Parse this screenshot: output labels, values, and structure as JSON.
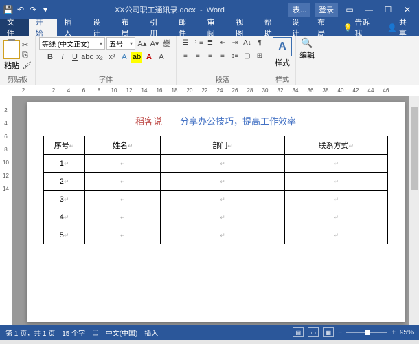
{
  "titlebar": {
    "doc_name": "XX公司职工通讯录.docx",
    "app": "Word",
    "table_tools": "表...",
    "login": "登录"
  },
  "tabs": {
    "file": "文件",
    "home": "开始",
    "insert": "插入",
    "design": "设计",
    "layout": "布局",
    "references": "引用",
    "mailings": "邮件",
    "review": "审阅",
    "view": "视图",
    "help": "帮助",
    "t_design": "设计",
    "t_layout": "布局",
    "tell_me": "告诉我",
    "share": "共享"
  },
  "ribbon": {
    "clipboard": {
      "paste": "粘贴",
      "label": "剪贴板"
    },
    "font": {
      "name": "等线 (中文正文)",
      "size": "五号",
      "label": "字体"
    },
    "paragraph": {
      "label": "段落"
    },
    "styles": {
      "btn": "样式",
      "label": "样式"
    },
    "editing": {
      "btn": "编辑"
    }
  },
  "ruler_h": [
    "2",
    "",
    "2",
    "4",
    "6",
    "8",
    "10",
    "12",
    "14",
    "16",
    "18",
    "20",
    "22",
    "24",
    "26",
    "28",
    "30",
    "32",
    "34",
    "36",
    "38",
    "40",
    "42",
    "44",
    "46"
  ],
  "ruler_v": [
    "",
    "2",
    "4",
    "6",
    "8",
    "10",
    "12",
    "14"
  ],
  "doc": {
    "title_red": "稻客说",
    "title_dash": "——",
    "title_blue": "分享办公技巧，提高工作效率",
    "headers": [
      "序号",
      "姓名",
      "部门",
      "联系方式"
    ],
    "rows": [
      [
        "1",
        "",
        "",
        ""
      ],
      [
        "2",
        "",
        "",
        ""
      ],
      [
        "3",
        "",
        "",
        ""
      ],
      [
        "4",
        "",
        "",
        ""
      ],
      [
        "5",
        "",
        "",
        ""
      ]
    ]
  },
  "status": {
    "page": "第 1 页，共 1 页",
    "words": "15 个字",
    "lang": "中文(中国)",
    "mode": "插入",
    "zoom": "95%"
  }
}
